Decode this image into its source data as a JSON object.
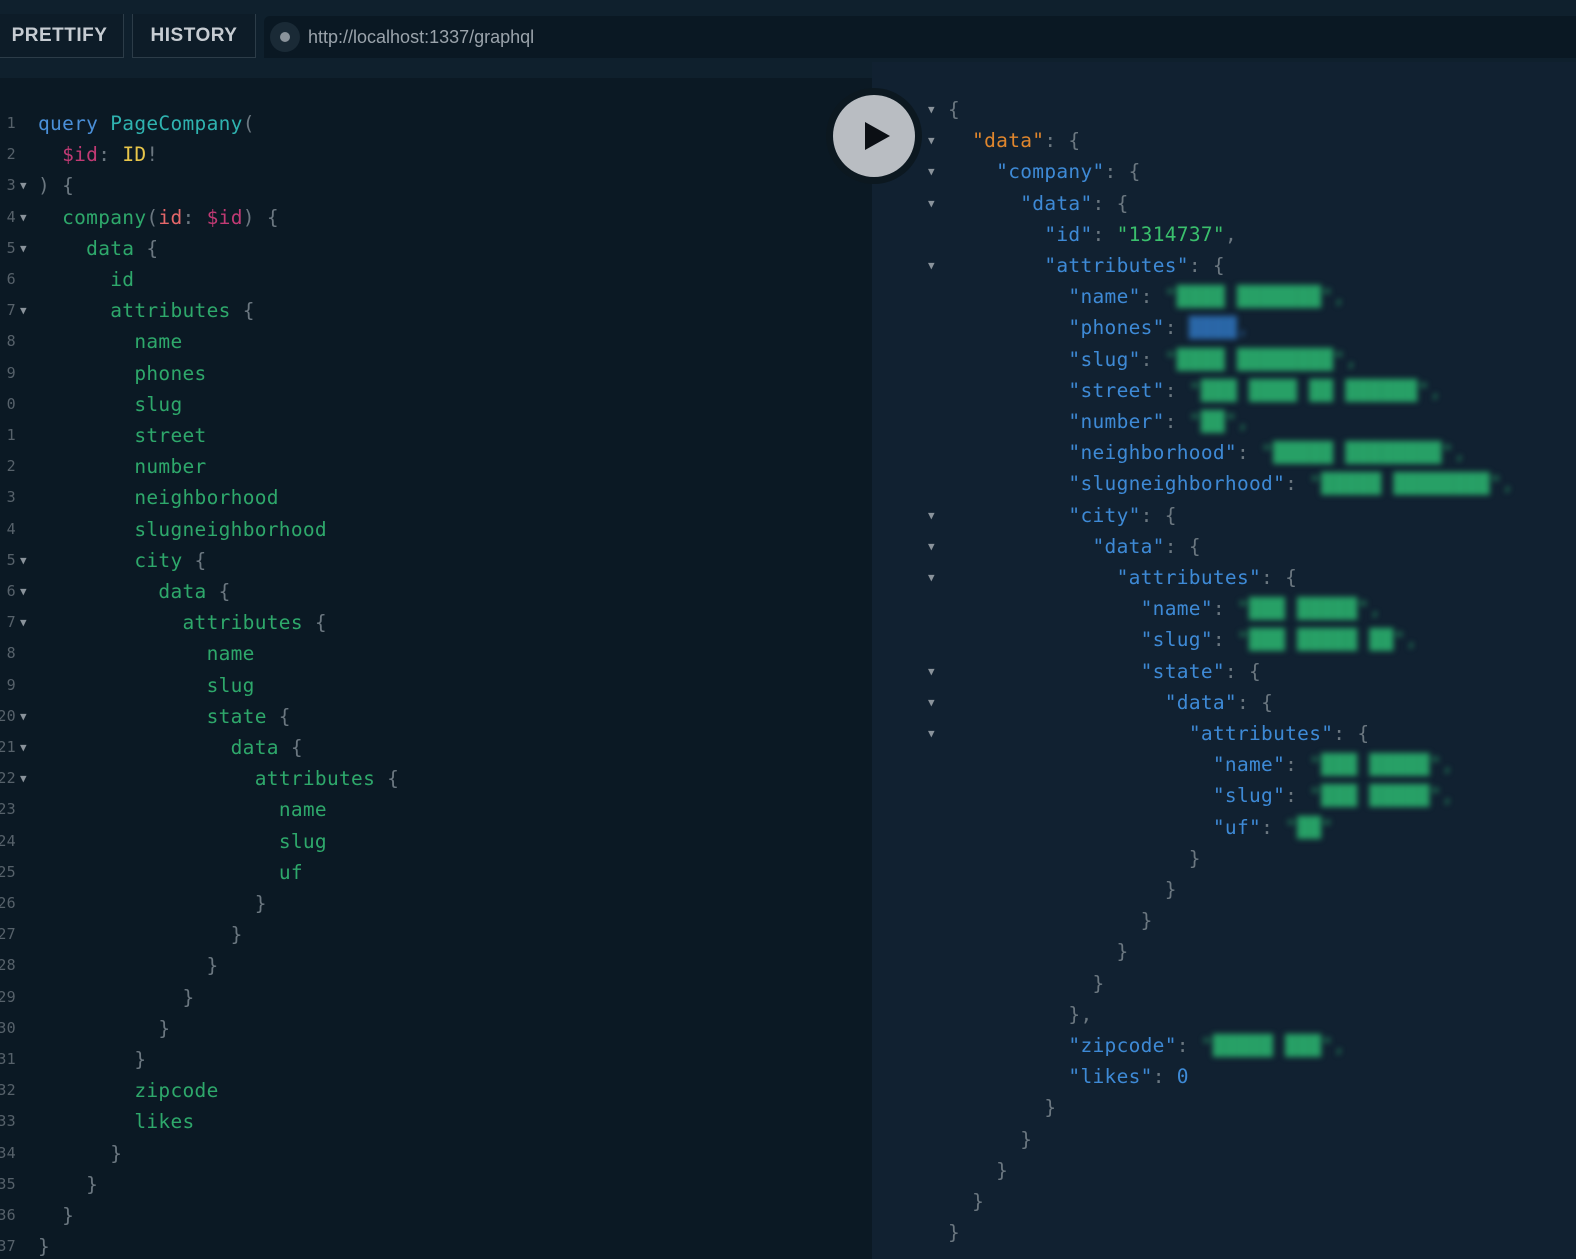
{
  "toolbar": {
    "prettify_label": "PRETTIFY",
    "history_label": "HISTORY",
    "endpoint_url": "http://localhost:1337/graphql"
  },
  "editor": {
    "lines": [
      {
        "n": "1",
        "fold": false,
        "tokens": [
          [
            "k",
            "query"
          ],
          [
            "p",
            " "
          ],
          [
            "def",
            "PageCompany"
          ],
          [
            "p",
            "("
          ]
        ]
      },
      {
        "n": "2",
        "fold": false,
        "tokens": [
          [
            "p",
            "  "
          ],
          [
            "var",
            "$id"
          ],
          [
            "p",
            ": "
          ],
          [
            "type",
            "ID"
          ],
          [
            "p",
            "!"
          ]
        ]
      },
      {
        "n": "3",
        "fold": true,
        "tokens": [
          [
            "p",
            ") {"
          ]
        ]
      },
      {
        "n": "4",
        "fold": true,
        "tokens": [
          [
            "p",
            "  "
          ],
          [
            "fld",
            "company"
          ],
          [
            "p",
            "("
          ],
          [
            "arg",
            "id"
          ],
          [
            "p",
            ": "
          ],
          [
            "var",
            "$id"
          ],
          [
            "p",
            ") {"
          ]
        ]
      },
      {
        "n": "5",
        "fold": true,
        "tokens": [
          [
            "p",
            "    "
          ],
          [
            "fld",
            "data"
          ],
          [
            "p",
            " {"
          ]
        ]
      },
      {
        "n": "6",
        "fold": false,
        "tokens": [
          [
            "p",
            "      "
          ],
          [
            "fld",
            "id"
          ]
        ]
      },
      {
        "n": "7",
        "fold": true,
        "tokens": [
          [
            "p",
            "      "
          ],
          [
            "fld",
            "attributes"
          ],
          [
            "p",
            " {"
          ]
        ]
      },
      {
        "n": "8",
        "fold": false,
        "tokens": [
          [
            "p",
            "        "
          ],
          [
            "fld",
            "name"
          ]
        ]
      },
      {
        "n": "9",
        "fold": false,
        "tokens": [
          [
            "p",
            "        "
          ],
          [
            "fld",
            "phones"
          ]
        ]
      },
      {
        "n": "0",
        "fold": false,
        "tokens": [
          [
            "p",
            "        "
          ],
          [
            "fld",
            "slug"
          ]
        ]
      },
      {
        "n": "1",
        "fold": false,
        "tokens": [
          [
            "p",
            "        "
          ],
          [
            "fld",
            "street"
          ]
        ]
      },
      {
        "n": "2",
        "fold": false,
        "tokens": [
          [
            "p",
            "        "
          ],
          [
            "fld",
            "number"
          ]
        ]
      },
      {
        "n": "3",
        "fold": false,
        "tokens": [
          [
            "p",
            "        "
          ],
          [
            "fld",
            "neighborhood"
          ]
        ]
      },
      {
        "n": "4",
        "fold": false,
        "tokens": [
          [
            "p",
            "        "
          ],
          [
            "fld",
            "slugneighborhood"
          ]
        ]
      },
      {
        "n": "5",
        "fold": true,
        "tokens": [
          [
            "p",
            "        "
          ],
          [
            "fld",
            "city"
          ],
          [
            "p",
            " {"
          ]
        ]
      },
      {
        "n": "6",
        "fold": true,
        "tokens": [
          [
            "p",
            "          "
          ],
          [
            "fld",
            "data"
          ],
          [
            "p",
            " {"
          ]
        ]
      },
      {
        "n": "7",
        "fold": true,
        "tokens": [
          [
            "p",
            "            "
          ],
          [
            "fld",
            "attributes"
          ],
          [
            "p",
            " {"
          ]
        ]
      },
      {
        "n": "8",
        "fold": false,
        "tokens": [
          [
            "p",
            "              "
          ],
          [
            "fld",
            "name"
          ]
        ]
      },
      {
        "n": "9",
        "fold": false,
        "tokens": [
          [
            "p",
            "              "
          ],
          [
            "fld",
            "slug"
          ]
        ]
      },
      {
        "n": "20",
        "fold": true,
        "tokens": [
          [
            "p",
            "              "
          ],
          [
            "fld",
            "state"
          ],
          [
            "p",
            " {"
          ]
        ]
      },
      {
        "n": "21",
        "fold": true,
        "tokens": [
          [
            "p",
            "                "
          ],
          [
            "fld",
            "data"
          ],
          [
            "p",
            " {"
          ]
        ]
      },
      {
        "n": "22",
        "fold": true,
        "tokens": [
          [
            "p",
            "                  "
          ],
          [
            "fld",
            "attributes"
          ],
          [
            "p",
            " {"
          ]
        ]
      },
      {
        "n": "23",
        "fold": false,
        "tokens": [
          [
            "p",
            "                    "
          ],
          [
            "fld",
            "name"
          ]
        ]
      },
      {
        "n": "24",
        "fold": false,
        "tokens": [
          [
            "p",
            "                    "
          ],
          [
            "fld",
            "slug"
          ]
        ]
      },
      {
        "n": "25",
        "fold": false,
        "tokens": [
          [
            "p",
            "                    "
          ],
          [
            "fld",
            "uf"
          ]
        ]
      },
      {
        "n": "26",
        "fold": false,
        "tokens": [
          [
            "p",
            "                  }"
          ]
        ]
      },
      {
        "n": "27",
        "fold": false,
        "tokens": [
          [
            "p",
            "                }"
          ]
        ]
      },
      {
        "n": "28",
        "fold": false,
        "tokens": [
          [
            "p",
            "              }"
          ]
        ]
      },
      {
        "n": "29",
        "fold": false,
        "tokens": [
          [
            "p",
            "            }"
          ]
        ]
      },
      {
        "n": "30",
        "fold": false,
        "tokens": [
          [
            "p",
            "          }"
          ]
        ]
      },
      {
        "n": "31",
        "fold": false,
        "tokens": [
          [
            "p",
            "        }"
          ]
        ]
      },
      {
        "n": "32",
        "fold": false,
        "tokens": [
          [
            "p",
            "        "
          ],
          [
            "fld",
            "zipcode"
          ]
        ]
      },
      {
        "n": "33",
        "fold": false,
        "tokens": [
          [
            "p",
            "        "
          ],
          [
            "fld",
            "likes"
          ]
        ]
      },
      {
        "n": "34",
        "fold": false,
        "tokens": [
          [
            "p",
            "      }"
          ]
        ]
      },
      {
        "n": "35",
        "fold": false,
        "tokens": [
          [
            "p",
            "    }"
          ]
        ]
      },
      {
        "n": "36",
        "fold": false,
        "tokens": [
          [
            "p",
            "  }"
          ]
        ]
      },
      {
        "n": "37",
        "fold": false,
        "tokens": [
          [
            "p",
            "}"
          ]
        ]
      }
    ]
  },
  "results": {
    "lines": [
      {
        "fold": true,
        "tokens": [
          [
            "p",
            "{"
          ]
        ]
      },
      {
        "fold": true,
        "tokens": [
          [
            "p",
            "  "
          ],
          [
            "dkey",
            "\"data\""
          ],
          [
            "p",
            ": {"
          ]
        ]
      },
      {
        "fold": true,
        "tokens": [
          [
            "p",
            "    "
          ],
          [
            "key",
            "\"company\""
          ],
          [
            "p",
            ": {"
          ]
        ]
      },
      {
        "fold": true,
        "tokens": [
          [
            "p",
            "      "
          ],
          [
            "key",
            "\"data\""
          ],
          [
            "p",
            ": {"
          ]
        ]
      },
      {
        "fold": false,
        "tokens": [
          [
            "p",
            "        "
          ],
          [
            "key",
            "\"id\""
          ],
          [
            "p",
            ": "
          ],
          [
            "str",
            "\"1314737\""
          ],
          [
            "p",
            ","
          ]
        ]
      },
      {
        "fold": true,
        "tokens": [
          [
            "p",
            "        "
          ],
          [
            "key",
            "\"attributes\""
          ],
          [
            "p",
            ": {"
          ]
        ]
      },
      {
        "fold": false,
        "tokens": [
          [
            "p",
            "          "
          ],
          [
            "key",
            "\"name\""
          ],
          [
            "p",
            ": "
          ],
          [
            "blur",
            "\"████ ███████\","
          ]
        ]
      },
      {
        "fold": false,
        "tokens": [
          [
            "p",
            "          "
          ],
          [
            "key",
            "\"phones\""
          ],
          [
            "p",
            ": "
          ],
          [
            "blurb",
            "████,"
          ]
        ]
      },
      {
        "fold": false,
        "tokens": [
          [
            "p",
            "          "
          ],
          [
            "key",
            "\"slug\""
          ],
          [
            "p",
            ": "
          ],
          [
            "blur",
            "\"████ ████████\","
          ]
        ]
      },
      {
        "fold": false,
        "tokens": [
          [
            "p",
            "          "
          ],
          [
            "key",
            "\"street\""
          ],
          [
            "p",
            ": "
          ],
          [
            "blur",
            "\"███ ████ ██ ██████\","
          ]
        ]
      },
      {
        "fold": false,
        "tokens": [
          [
            "p",
            "          "
          ],
          [
            "key",
            "\"number\""
          ],
          [
            "p",
            ": "
          ],
          [
            "blur",
            "\"██\","
          ]
        ]
      },
      {
        "fold": false,
        "tokens": [
          [
            "p",
            "          "
          ],
          [
            "key",
            "\"neighborhood\""
          ],
          [
            "p",
            ": "
          ],
          [
            "blur",
            "\"█████ ████████\","
          ]
        ]
      },
      {
        "fold": false,
        "tokens": [
          [
            "p",
            "          "
          ],
          [
            "key",
            "\"slugneighborhood\""
          ],
          [
            "p",
            ": "
          ],
          [
            "blur",
            "\"█████ ████████\","
          ]
        ]
      },
      {
        "fold": true,
        "tokens": [
          [
            "p",
            "          "
          ],
          [
            "key",
            "\"city\""
          ],
          [
            "p",
            ": {"
          ]
        ]
      },
      {
        "fold": true,
        "tokens": [
          [
            "p",
            "            "
          ],
          [
            "key",
            "\"data\""
          ],
          [
            "p",
            ": {"
          ]
        ]
      },
      {
        "fold": true,
        "tokens": [
          [
            "p",
            "              "
          ],
          [
            "key",
            "\"attributes\""
          ],
          [
            "p",
            ": {"
          ]
        ]
      },
      {
        "fold": false,
        "tokens": [
          [
            "p",
            "                "
          ],
          [
            "key",
            "\"name\""
          ],
          [
            "p",
            ": "
          ],
          [
            "blur",
            "\"███ █████\","
          ]
        ]
      },
      {
        "fold": false,
        "tokens": [
          [
            "p",
            "                "
          ],
          [
            "key",
            "\"slug\""
          ],
          [
            "p",
            ": "
          ],
          [
            "blur",
            "\"███ █████ ██\","
          ]
        ]
      },
      {
        "fold": true,
        "tokens": [
          [
            "p",
            "                "
          ],
          [
            "key",
            "\"state\""
          ],
          [
            "p",
            ": {"
          ]
        ]
      },
      {
        "fold": true,
        "tokens": [
          [
            "p",
            "                  "
          ],
          [
            "key",
            "\"data\""
          ],
          [
            "p",
            ": {"
          ]
        ]
      },
      {
        "fold": true,
        "tokens": [
          [
            "p",
            "                    "
          ],
          [
            "key",
            "\"attributes\""
          ],
          [
            "p",
            ": {"
          ]
        ]
      },
      {
        "fold": false,
        "tokens": [
          [
            "p",
            "                      "
          ],
          [
            "key",
            "\"name\""
          ],
          [
            "p",
            ": "
          ],
          [
            "blur",
            "\"███ █████\","
          ]
        ]
      },
      {
        "fold": false,
        "tokens": [
          [
            "p",
            "                      "
          ],
          [
            "key",
            "\"slug\""
          ],
          [
            "p",
            ": "
          ],
          [
            "blur",
            "\"███ █████\","
          ]
        ]
      },
      {
        "fold": false,
        "tokens": [
          [
            "p",
            "                      "
          ],
          [
            "key",
            "\"uf\""
          ],
          [
            "p",
            ": "
          ],
          [
            "blur",
            "\"██\""
          ]
        ]
      },
      {
        "fold": false,
        "tokens": [
          [
            "p",
            "                    }"
          ]
        ]
      },
      {
        "fold": false,
        "tokens": [
          [
            "p",
            "                  }"
          ]
        ]
      },
      {
        "fold": false,
        "tokens": [
          [
            "p",
            "                }"
          ]
        ]
      },
      {
        "fold": false,
        "tokens": [
          [
            "p",
            "              }"
          ]
        ]
      },
      {
        "fold": false,
        "tokens": [
          [
            "p",
            "            }"
          ]
        ]
      },
      {
        "fold": false,
        "tokens": [
          [
            "p",
            "          },"
          ]
        ]
      },
      {
        "fold": false,
        "tokens": [
          [
            "p",
            "          "
          ],
          [
            "key",
            "\"zipcode\""
          ],
          [
            "p",
            ": "
          ],
          [
            "blur",
            "\"█████ ███\","
          ]
        ]
      },
      {
        "fold": false,
        "tokens": [
          [
            "p",
            "          "
          ],
          [
            "key",
            "\"likes\""
          ],
          [
            "p",
            ": "
          ],
          [
            "num",
            "0"
          ]
        ]
      },
      {
        "fold": false,
        "tokens": [
          [
            "p",
            "        }"
          ]
        ]
      },
      {
        "fold": false,
        "tokens": [
          [
            "p",
            "      }"
          ]
        ]
      },
      {
        "fold": false,
        "tokens": [
          [
            "p",
            "    }"
          ]
        ]
      },
      {
        "fold": false,
        "tokens": [
          [
            "p",
            "  }"
          ]
        ]
      },
      {
        "fold": false,
        "tokens": [
          [
            "p",
            "}"
          ]
        ]
      }
    ]
  }
}
